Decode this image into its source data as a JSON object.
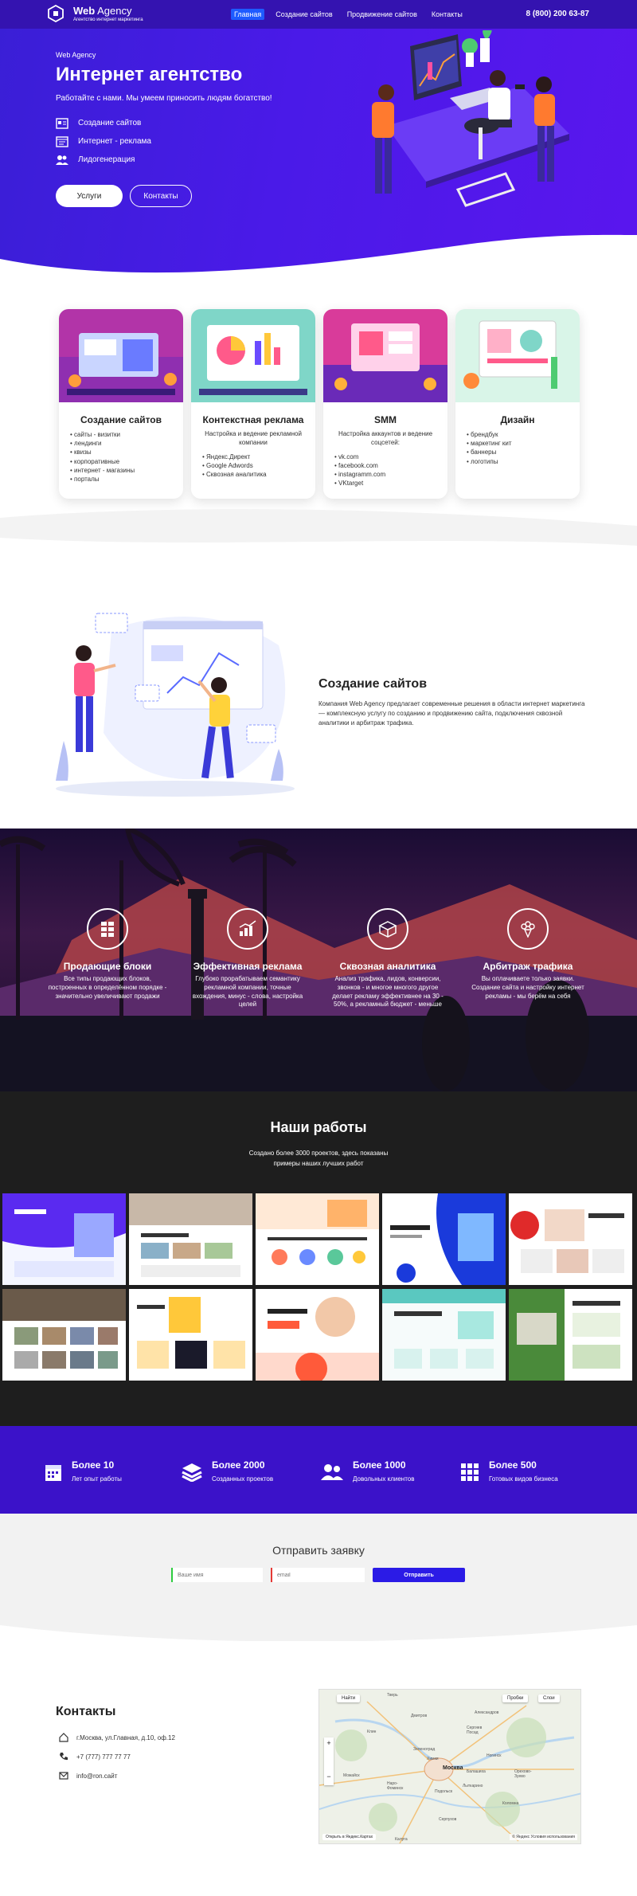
{
  "header": {
    "logo_title_bold": "Web",
    "logo_title_rest": " Agency",
    "logo_subtitle": "Агентство интернет маркетинга",
    "menu": [
      "Главная",
      "Создание сайтов",
      "Продвижение сайтов",
      "Контакты"
    ],
    "phone": "8 (800) 200 63-87"
  },
  "hero": {
    "kicker": "Web Agency",
    "title": "Интернет агентство",
    "subtitle": "Работайте с нами. Мы умеем приносить людям богатство!",
    "bullets": [
      "Создание сайтов",
      "Интернет - реклама",
      "Лидогенерация"
    ],
    "btn_services": "Услуги",
    "btn_contacts": "Контакты"
  },
  "services": [
    {
      "title": "Создание сайтов",
      "desc": "",
      "items": [
        "сайты - визитки",
        "лендинги",
        "квизы",
        "корпоративные",
        "интернет - магазины",
        "порталы"
      ]
    },
    {
      "title": "Контекстная реклама",
      "desc": "Настройка и ведение рекламной компании",
      "items": [
        "Яндекс.Директ",
        "Google Adwords",
        "Сквозная аналитика"
      ]
    },
    {
      "title": "SMM",
      "desc": "Настройка аккаунтов и ведение соцсетей:",
      "items": [
        "vk.com",
        "facebook.com",
        "instagramm.com",
        "VKtarget"
      ]
    },
    {
      "title": "Дизайн",
      "desc": "",
      "items": [
        "брендбук",
        "маркетинг кит",
        "баннеры",
        "логотипы"
      ]
    }
  ],
  "about": {
    "title": "Создание сайтов",
    "text": "Компания Web Agency предлагает современные решения в области интернет маркетинга — комплексную услугу по созданию и продвижению сайта, подключения сквозной аналитики и арбитраж трафика."
  },
  "features": [
    {
      "title": "Продающие блоки",
      "text": "Все типы продающих блоков, построенных в определённом порядке - значительно увеличивают продажи",
      "icon": "grid-icon"
    },
    {
      "title": "Эффективная реклама",
      "text": "Глубоко прорабатываем семантику рекламной компании, точные вхождения, минус - слова, настройка целей",
      "icon": "chart-up-icon"
    },
    {
      "title": "Сквозная аналитика",
      "text": "Анализ трафика, лидов, конверсии, звонков - и многое многого другое делает рекламу эффективнее на 30 - 50%, а рекламный бюджет - меньше",
      "icon": "box-icon"
    },
    {
      "title": "Арбитраж трафика",
      "text": "Вы оплачиваете только заявки. Создание сайта и настройку интернет рекламы - мы берём на себя",
      "icon": "bouquet-icon"
    }
  ],
  "works": {
    "title": "Наши работы",
    "text": "Создано более 3000 проектов, здесь показаны примеры наших лучших работ"
  },
  "stats": [
    {
      "value": "Более 10",
      "label": "Лет опыт работы",
      "icon": "calendar-icon"
    },
    {
      "value": "Более 2000",
      "label": "Созданных проектов",
      "icon": "layers-icon"
    },
    {
      "value": "Более 1000",
      "label": "Довольных клиентов",
      "icon": "users-icon"
    },
    {
      "value": "Более 500",
      "label": "Готовых видов бизнеса",
      "icon": "apps-icon"
    }
  ],
  "form": {
    "title": "Отправить заявку",
    "name_placeholder": "Ваше имя",
    "email_placeholder": "email",
    "submit": "Отправить"
  },
  "contacts": {
    "title": "Контакты",
    "address": "г.Москва, ул.Главная, д.10, оф.12",
    "phone": "+7 (777) 777 77 77",
    "email": "info@ron.сайт"
  },
  "map": {
    "btn_find": "Найти",
    "btn_traffic": "Пробки",
    "btn_layers": "Слои",
    "open_link": "Открыть в Яндекс.Картах",
    "copyright": "© Яндекс  Условия использования",
    "cities": [
      "Тверь",
      "Дмитров",
      "Сергиев Посад",
      "Александров",
      "Клин",
      "Зеленоград",
      "Химки",
      "Москва",
      "Балашиха",
      "Подольск",
      "Наро-Фоминск",
      "Серпухов",
      "Коломна",
      "Можайск",
      "Калуга",
      "Орехово-Зуево",
      "Ногинск",
      "Лыткарино"
    ]
  },
  "colors": {
    "primary": "#3b12c9",
    "accent": "#1e5bff",
    "dark": "#1e1e1e"
  }
}
